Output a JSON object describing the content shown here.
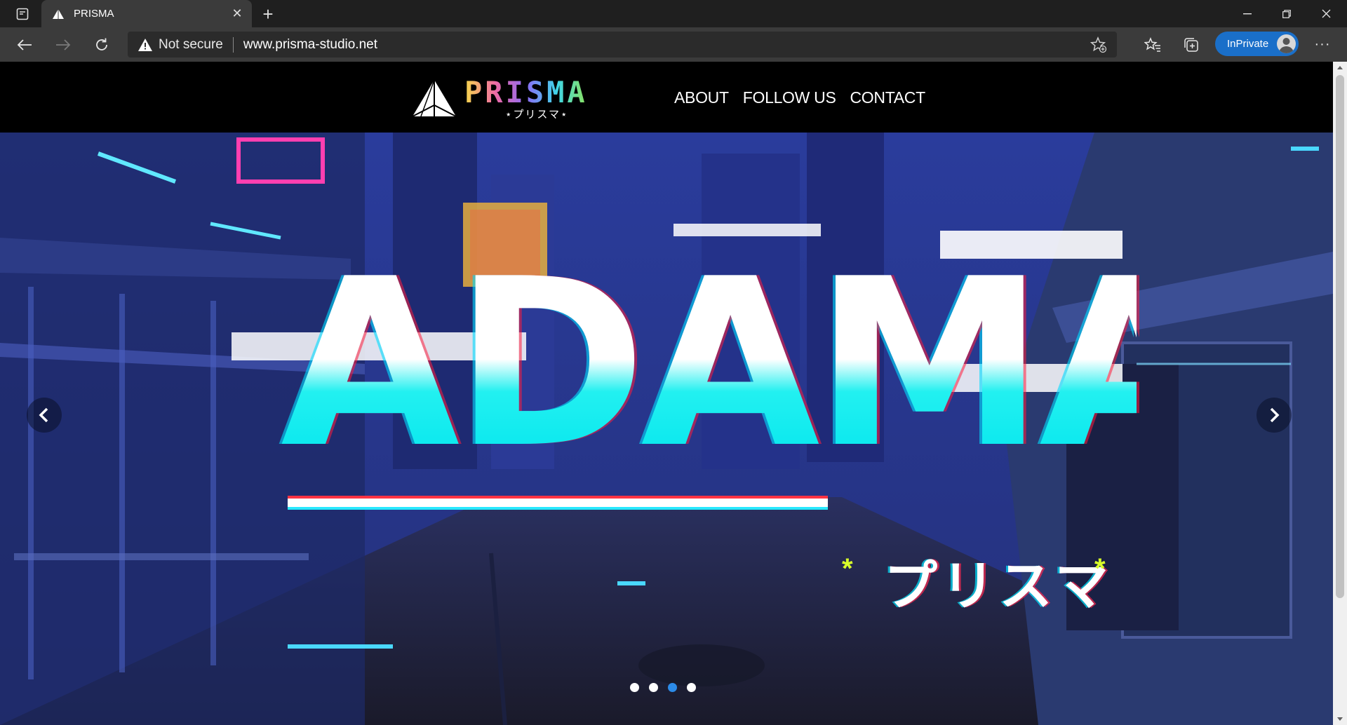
{
  "browser": {
    "tab": {
      "title": "PRISMA",
      "favicon": "prisma-triangle-icon"
    },
    "address": {
      "security_label": "Not secure",
      "url": "www.prisma-studio.net"
    },
    "profile": {
      "label": "InPrivate"
    }
  },
  "site": {
    "logo": {
      "word": "PRISMA",
      "subtitle": "⋆プリスマ⋆"
    },
    "nav": [
      {
        "label": "ABOUT"
      },
      {
        "label": "FOLLOW US"
      },
      {
        "label": "CONTACT"
      }
    ],
    "hero": {
      "title": "ADAMAS",
      "subtitle": "プリスマ",
      "slides_total": 4,
      "active_slide": 3
    }
  },
  "colors": {
    "accent": "#1a6fc9",
    "logo_gradient": [
      "#f6d84b",
      "#f06aa5",
      "#8c6cf5",
      "#3fd7e8",
      "#8ee35a"
    ],
    "hero_cyan": "#00e5ee",
    "dot_active": "#2c8be8"
  }
}
